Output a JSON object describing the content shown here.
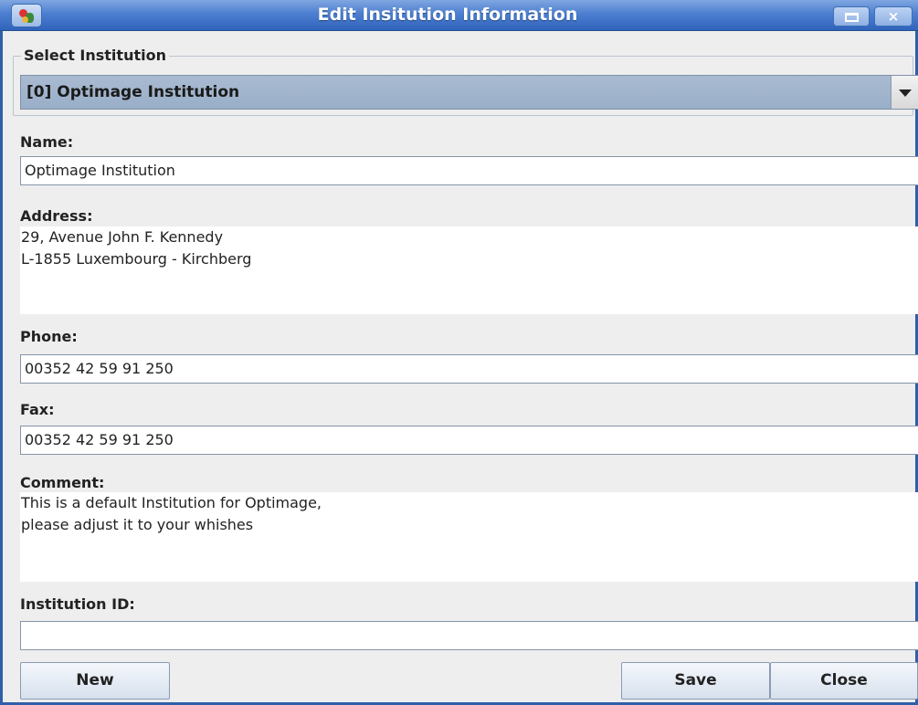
{
  "window": {
    "title": "Edit Insitution Information",
    "icon": "app-icon",
    "controls": {
      "maximize": "maximize-icon",
      "close": "×"
    }
  },
  "select_group": {
    "title": "Select Institution",
    "selected": "[0] Optimage Institution"
  },
  "form": {
    "name_label": "Name:",
    "name_value": "Optimage Institution",
    "address_label": "Address:",
    "address_value": "29, Avenue John F. Kennedy\nL-1855 Luxembourg - Kirchberg",
    "phone_label": "Phone:",
    "phone_value": "00352 42 59 91 250",
    "fax_label": "Fax:",
    "fax_value": "00352 42 59 91 250",
    "comment_label": "Comment:",
    "comment_value": "This is a default Institution for Optimage,\nplease adjust it to your whishes",
    "institution_id_label": "Institution ID:",
    "institution_id_value": ""
  },
  "buttons": {
    "new": "New",
    "save": "Save",
    "close": "Close"
  },
  "colors": {
    "titlebar": "#4d7fd0",
    "combo": "#a9bbd1",
    "background": "#eeeeee"
  }
}
